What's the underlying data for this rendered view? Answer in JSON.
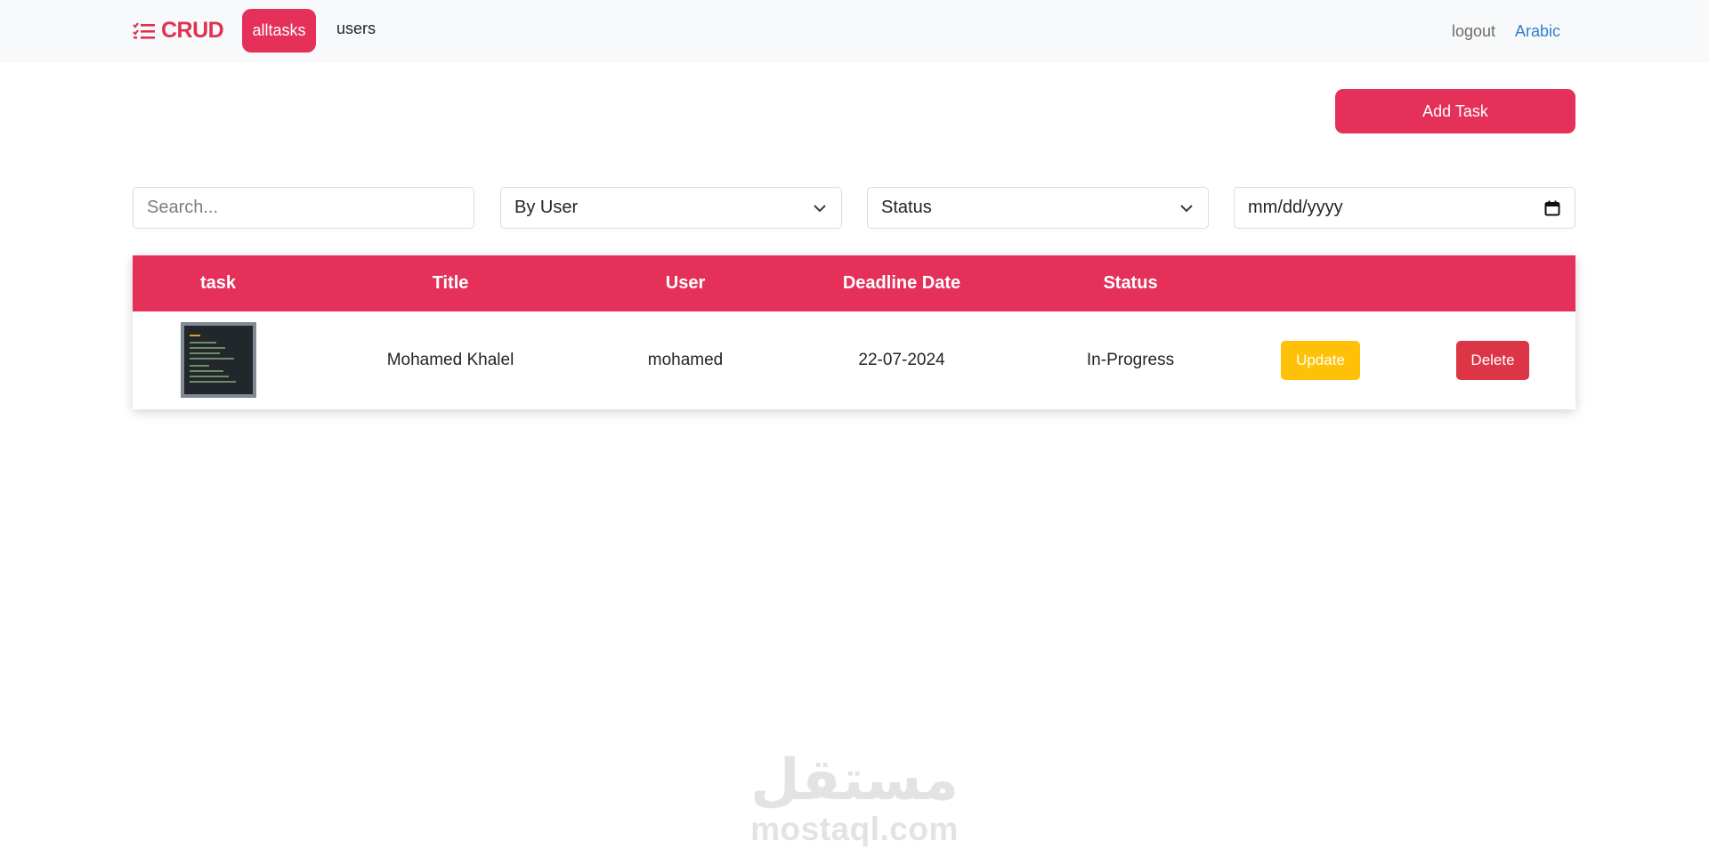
{
  "navbar": {
    "brand": "CRUD",
    "tabs": [
      {
        "label": "alltasks",
        "active": true
      },
      {
        "label": "users",
        "active": false
      }
    ],
    "logout": "logout",
    "language": "Arabic"
  },
  "toolbar": {
    "add_task_label": "Add Task"
  },
  "filters": {
    "search_placeholder": "Search...",
    "user_select_value": "By User",
    "status_select_value": "Status",
    "date_placeholder": "mm/dd/yyyy"
  },
  "table": {
    "columns": [
      "task",
      "Title",
      "User",
      "Deadline Date",
      "Status"
    ],
    "rows": [
      {
        "title": "Mohamed Khalel",
        "user": "mohamed",
        "deadline": "22-07-2024",
        "status": "In-Progress",
        "update_label": "Update",
        "delete_label": "Delete"
      }
    ]
  },
  "watermark": {
    "arabic": "مستقل",
    "latin": "mostaql.com"
  },
  "colors": {
    "accent": "#e5305a",
    "warning": "#ffc107",
    "danger": "#dc3545",
    "link": "#2f7fd1"
  }
}
